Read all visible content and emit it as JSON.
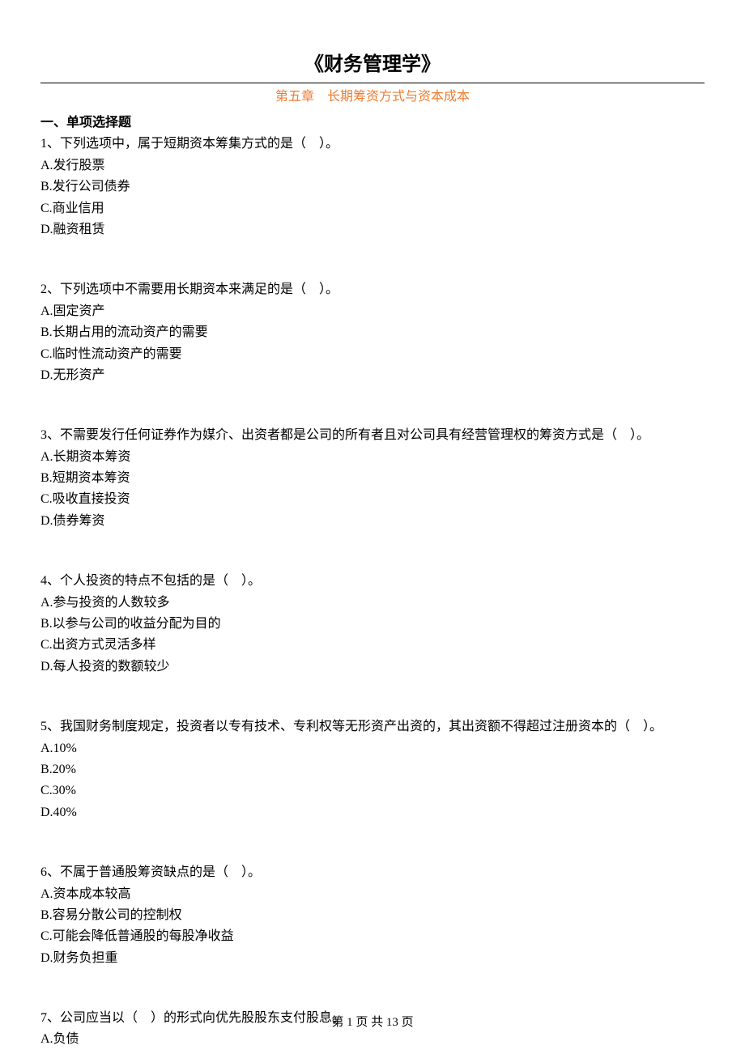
{
  "title": "《财务管理学》",
  "subtitle": "第五章　长期筹资方式与资本成本",
  "section_heading": "一、单项选择题",
  "questions": [
    {
      "stem": "1、下列选项中，属于短期资本筹集方式的是（　）。",
      "opts": [
        "A.发行股票",
        "B.发行公司债券",
        "C.商业信用",
        "D.融资租赁"
      ]
    },
    {
      "stem": "2、下列选项中不需要用长期资本来满足的是（　）。",
      "opts": [
        "A.固定资产",
        "B.长期占用的流动资产的需要",
        "C.临时性流动资产的需要",
        "D.无形资产"
      ]
    },
    {
      "stem": "3、不需要发行任何证券作为媒介、出资者都是公司的所有者且对公司具有经营管理权的筹资方式是（　）。",
      "opts": [
        "A.长期资本筹资",
        "B.短期资本筹资",
        "C.吸收直接投资",
        "D.债券筹资"
      ]
    },
    {
      "stem": "4、个人投资的特点不包括的是（　）。",
      "opts": [
        "A.参与投资的人数较多",
        "B.以参与公司的收益分配为目的",
        "C.出资方式灵活多样",
        "D.每人投资的数额较少"
      ]
    },
    {
      "stem": "5、我国财务制度规定，投资者以专有技术、专利权等无形资产出资的，其出资额不得超过注册资本的（　）。",
      "opts": [
        "A.10%",
        "B.20%",
        "C.30%",
        "D.40%"
      ]
    },
    {
      "stem": "6、不属于普通股筹资缺点的是（　）。",
      "opts": [
        "A.资本成本较高",
        "B.容易分散公司的控制权",
        "C.可能会降低普通股的每股净收益",
        "D.财务负担重"
      ]
    },
    {
      "stem": "7、公司应当以（　）的形式向优先股股东支付股息。",
      "opts": [
        "A.负债"
      ]
    }
  ],
  "footer": "第 1 页 共 13 页"
}
